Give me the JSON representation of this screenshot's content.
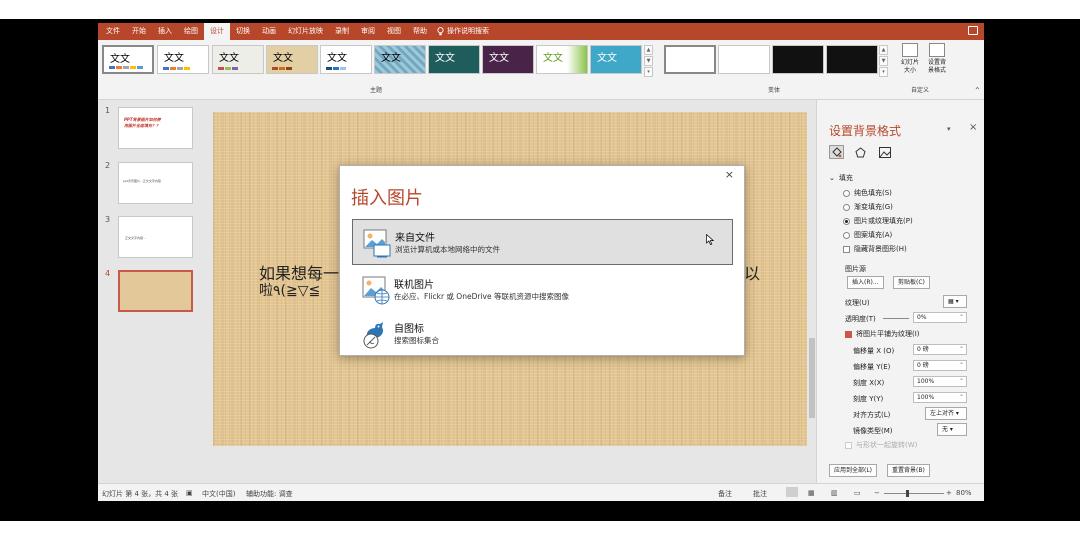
{
  "menu": {
    "items": [
      "文件",
      "开始",
      "插入",
      "绘图",
      "设计",
      "切换",
      "动画",
      "幻灯片放映",
      "录制",
      "审阅",
      "视图",
      "帮助"
    ],
    "active_index": 4,
    "search_label": "操作说明搜索"
  },
  "ribbon": {
    "theme_sample_text": "文文",
    "themes_group_label": "主题",
    "variants_group_label": "变体",
    "custom_group_label": "自定义",
    "slide_size_label": "幻灯片\n大小",
    "format_bg_label": "设置背\n景格式"
  },
  "thumbnails": {
    "items": [
      {
        "num": "1",
        "text": "PPT背景图片如何使\n用图片全面填充？？"
      },
      {
        "num": "2",
        "text": "ppt背景图片...正文文字内容"
      },
      {
        "num": "3",
        "text": "正文文字内容..."
      },
      {
        "num": "4",
        "text": ""
      }
    ],
    "active_index": 3
  },
  "slide": {
    "text_left": "如果想每一",
    "text_right": "以",
    "text_left2": "啦٩(≧▽≦",
    "text_right2": ""
  },
  "format_pane": {
    "title": "设置背景格式",
    "section_fill": "填充",
    "fill_options": [
      "纯色填充(S)",
      "渐变填充(G)",
      "图片或纹理填充(P)",
      "图案填充(A)"
    ],
    "fill_selected": 2,
    "hide_bg_label": "隐藏背景图形(H)",
    "source_label": "图片源",
    "insert_btn": "插入(R)...",
    "clipboard_btn": "剪贴板(C)",
    "texture_label": "纹理(U)",
    "transparency_label": "透明度(T)",
    "transparency_value": "0%",
    "tile_label": "将图片平铺为纹理(I)",
    "offset_x_label": "偏移量 X (O)",
    "offset_x_value": "0 磅",
    "offset_y_label": "偏移量 Y(E)",
    "offset_y_value": "0 磅",
    "scale_x_label": "刻度 X(X)",
    "scale_x_value": "100%",
    "scale_y_label": "刻度 Y(Y)",
    "scale_y_value": "100%",
    "align_label": "对齐方式(L)",
    "align_value": "左上对齐",
    "mirror_label": "镜像类型(M)",
    "mirror_value": "无",
    "rotate_label": "与形状一起旋转(W)",
    "apply_all_btn": "应用到全部(L)",
    "reset_btn": "重置背景(B)"
  },
  "status": {
    "slide_info": "幻灯片 第 4 张，共 4 张",
    "language": "中文(中国)",
    "accessibility": "辅助功能: 调查",
    "notes": "备注",
    "comments": "批注",
    "zoom": "80%"
  },
  "dialog": {
    "title": "插入图片",
    "close": "×",
    "options": [
      {
        "title": "来自文件",
        "desc": "浏览计算机或本地网络中的文件"
      },
      {
        "title": "联机图片",
        "desc": "在必应、Flickr 或 OneDrive 等联机资源中搜索图像"
      },
      {
        "title": "自图标",
        "desc": "搜索图标集合"
      }
    ]
  },
  "colors": {
    "accent": "#b7472a",
    "slide_bg": "#e4c692",
    "ribbon_bg": "#f3f3f3"
  }
}
